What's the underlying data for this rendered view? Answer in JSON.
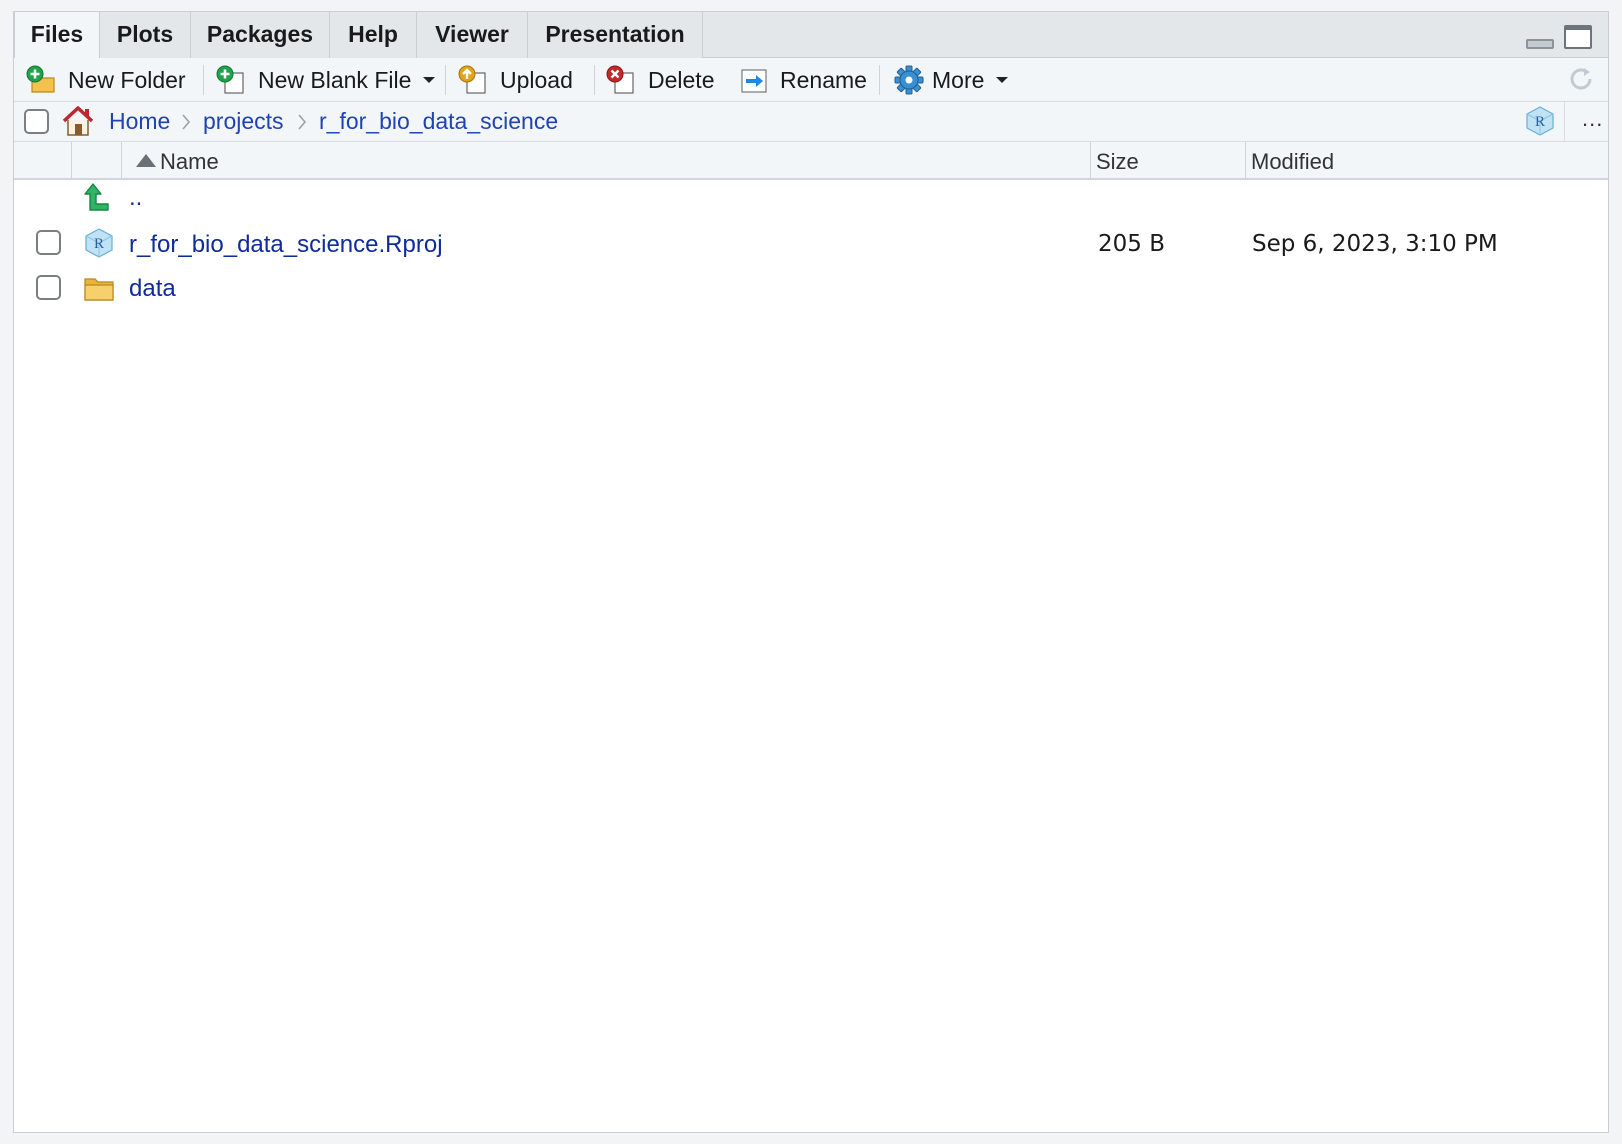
{
  "tabs": [
    {
      "label": "Files",
      "active": true
    },
    {
      "label": "Plots"
    },
    {
      "label": "Packages"
    },
    {
      "label": "Help"
    },
    {
      "label": "Viewer"
    },
    {
      "label": "Presentation"
    }
  ],
  "toolbar": {
    "new_folder": "New Folder",
    "new_blank_file": "New Blank File",
    "upload": "Upload",
    "delete": "Delete",
    "rename": "Rename",
    "more": "More"
  },
  "breadcrumb": {
    "items": [
      "Home",
      "projects",
      "r_for_bio_data_science"
    ],
    "more": "..."
  },
  "columns": {
    "name": "Name",
    "size": "Size",
    "modified": "Modified",
    "sort": "ascending"
  },
  "rows": [
    {
      "name": "..",
      "type": "parent",
      "size": "",
      "modified": ""
    },
    {
      "name": "r_for_bio_data_science.Rproj",
      "type": "rproj",
      "size": "205 B",
      "modified": "Sep 6, 2023, 3:10 PM"
    },
    {
      "name": "data",
      "type": "folder",
      "size": "",
      "modified": ""
    }
  ],
  "colors": {
    "link": "#1f43b0",
    "file_link": "#0f2b9c",
    "toolbar_bg": "#f3f6f8",
    "tab_bg": "#e4e7ea"
  }
}
